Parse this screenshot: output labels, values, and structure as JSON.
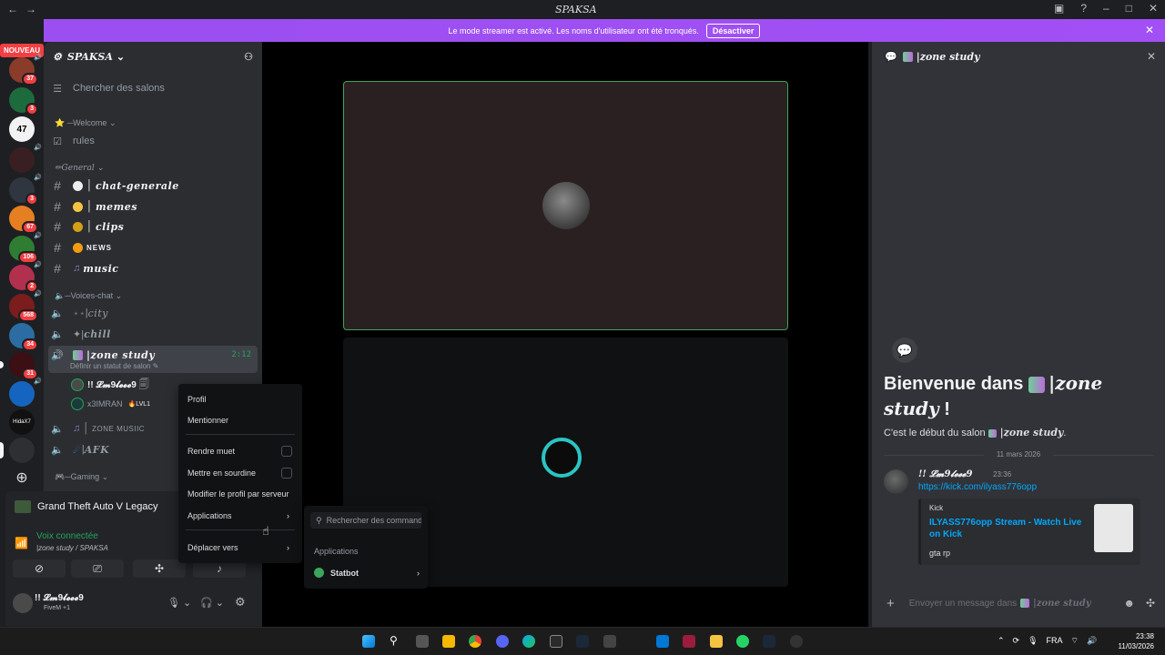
{
  "window": {
    "title": "SPAKSA",
    "nav_back": "←",
    "nav_forward": "→"
  },
  "banner": {
    "text": "Le mode streamer est activé. Les noms d'utilisateur ont été tronqués.",
    "button": "Désactiver"
  },
  "rail": {
    "nouveau": "NOUVEAU",
    "badges": [
      "37",
      "3",
      "3",
      "67",
      "106",
      "2",
      "568",
      "34",
      "31"
    ],
    "server_labels": [
      "47",
      "HidaX7"
    ]
  },
  "guild": {
    "name": "SPAKSA",
    "search": "Chercher des salons"
  },
  "categories": {
    "welcome": "Welcome",
    "general": "General",
    "voices": "Voices-chat",
    "gaming": "Gaming"
  },
  "channels": {
    "rules": "rules",
    "chat_generale": "chat-generale",
    "memes": "memes",
    "clips": "clips",
    "news": "NEWS",
    "music": "music",
    "city": "city",
    "chill": "chill",
    "zone_study": "|zone study",
    "zone_study_time": "2:12",
    "zone_study_status": "Définir un statut de salon",
    "zone_music": "ZONE MUSIIC",
    "afk": "AFK"
  },
  "voice_members": [
    {
      "name": "!! 𝓛𝓶9𝓵𝓮𝓮𝓮9",
      "tag": ""
    },
    {
      "name": "x3IMRAN",
      "tag": "LVL1"
    }
  ],
  "activity": {
    "game": "Grand Theft Auto V Legacy",
    "voice_status": "Voix connectée",
    "voice_channel": "|zone study / SPAKSA"
  },
  "user": {
    "name": "!! 𝓛𝓶9𝓵𝓮𝓮𝓮9",
    "status": "FiveM +1"
  },
  "context_menu": {
    "profil": "Profil",
    "mentionner": "Mentionner",
    "rendre_muet": "Rendre muet",
    "sourdine": "Mettre en sourdine",
    "modifier": "Modifier le profil par serveur",
    "applications": "Applications",
    "deplacer": "Déplacer vers"
  },
  "submenu": {
    "search_placeholder": "Rechercher des commandes",
    "section": "Applications",
    "app": "Statbot"
  },
  "chat": {
    "header": "|zone study",
    "welcome_prefix": "Bienvenue dans",
    "welcome_channel": "|zone study",
    "welcome_suffix": "!",
    "welcome_sub_prefix": "C'est le début du salon",
    "welcome_sub_channel": "|zone study",
    "date": "11 mars 2026",
    "message": {
      "author": "!! 𝓛𝓶9𝓵𝓮𝓮𝓮9",
      "time": "23:36",
      "link": "https://kick.com/ilyass776opp",
      "embed_provider": "Kick",
      "embed_title": "ILYASS776opp Stream - Watch Live on Kick",
      "embed_desc": "gta rp"
    },
    "input_placeholder": "Envoyer un message dans",
    "input_channel": "|zone study"
  },
  "taskbar": {
    "lang": "FRA",
    "time": "23:38",
    "date": "11/03/2026"
  },
  "colors": {
    "accent": "#a24ff5",
    "link": "#00a8fc",
    "online": "#23a55a",
    "danger": "#f23f43"
  }
}
